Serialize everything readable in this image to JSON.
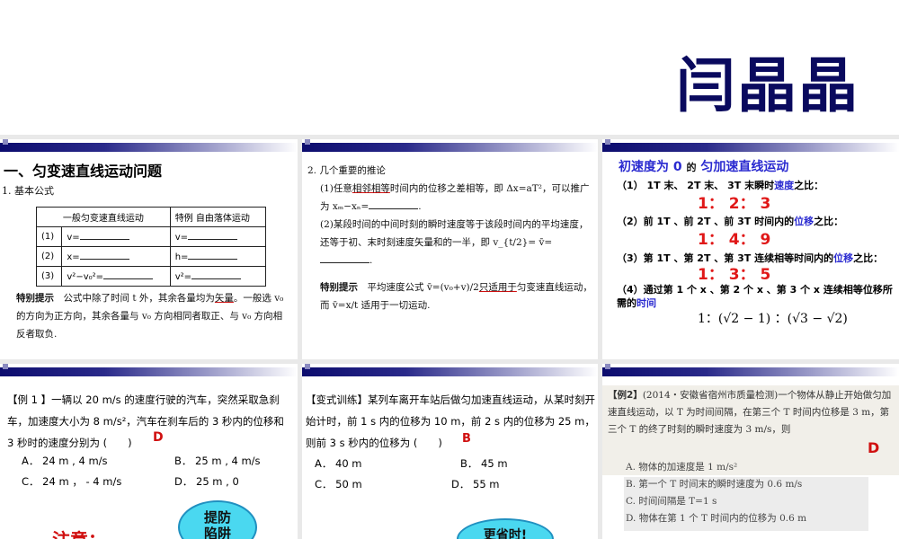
{
  "header": {
    "author_name": "闫晶晶"
  },
  "slide1": {
    "title": "一、匀变速直线运动问题",
    "subtitle": "1. 基本公式",
    "table": {
      "headers": [
        "一般匀变速直线运动",
        "特例 自由落体运动"
      ],
      "rows": [
        {
          "num": "(1)",
          "general": "v=",
          "special": "v="
        },
        {
          "num": "(2)",
          "general": "x=",
          "special": "h="
        },
        {
          "num": "(3)",
          "general": "v²−v₀²=",
          "special": "v²="
        }
      ]
    },
    "tip_label": "特别提示",
    "tip_text_1": "公式中除了时间 t 外，其余各量均为",
    "tip_highlight": "矢量",
    "tip_text_2": "。一般选 v₀ 的方向为正方向，其余各量与 v₀ 方向相同者取正、与 v₀ 方向相反者取负."
  },
  "slide2": {
    "heading": "2. 几个重要的推论",
    "p1_a": "(1)任意",
    "p1_hl": "相邻相等",
    "p1_b": "时间内的位移之差相等，即 Δx=aT²，可以推广为 xₘ−xₙ=",
    "p2": "(2)某段时间的中间时刻的瞬时速度等于该段时间内的平均速度，还等于初、末时刻速度矢量和的一半，即 v_{t/2}= v̄=",
    "tip_label": "特别提示",
    "tip_a": "平均速度公式 v̄=(v₀+v)/2",
    "tip_hl": "只适用于",
    "tip_b": "匀变速直线运动，而 v̄=x/t 适用于一切运动."
  },
  "slide3": {
    "title_a": "初速度为 0",
    "title_mid": "的",
    "title_b": "匀加速直线运动",
    "q1_a": "（1） 1T 末、 2T 末、 3T 末瞬时",
    "q1_kw": "速度",
    "q1_b": "之比：",
    "r1": "1： 2： 3",
    "q2_a": "（2）前 1T 、前 2T 、前 3T 时间内的",
    "q2_kw": "位移",
    "q2_b": "之比：",
    "r2": "1： 4： 9",
    "q3_a": "（3）第 1T 、第 2T 、第 3T 连续相等时间内的",
    "q3_kw": "位移",
    "q3_b": "之比：",
    "r3": "1： 3： 5",
    "q4_a": "（4）通过第 1 个 x 、第 2 个 x 、第 3 个 x 连续相等位移所需的",
    "q4_kw": "时间",
    "r4": "1：(√2 − 1) ：(√3 − √2)"
  },
  "slide4": {
    "question": "【例 1 】一辆以 20 m/s 的速度行驶的汽车，突然采取急刹车，加速度大小为 8 m/s²，汽车在刹车后的 3 秒内的位移和 3 秒时的速度分别为 (　　)",
    "answer": "D",
    "options": [
      "A． 24 m , 4 m/s",
      "B． 25 m , 4 m/s",
      "C． 24 m ， - 4 m/s",
      "D． 25 m , 0"
    ],
    "note": "注意：",
    "cloud": "提防陷阱"
  },
  "slide5": {
    "question": "【变式训练】某列车离开车站后做匀加速直线运动，从某时刻开始计时，前 1 s 内的位移为 10 m，前 2 s 内的位移为 25 m，则前 3 s 秒内的位移为 (　　)",
    "answer": "B",
    "options": [
      "A． 40 m",
      "B． 45 m",
      "C． 50 m",
      "D． 55 m"
    ],
    "cloud": "更省时!"
  },
  "slide6": {
    "label": "【例2】",
    "question": "(2014・安徽省宿州市质量检测)一个物体从静止开始做匀加速直线运动，以 T 为时间间隔，在第三个 T 时间内位移是 3 m，第三个 T 的终了时刻的瞬时速度为 3 m/s，则",
    "answer": "D",
    "options": [
      "A. 物体的加速度是 1 m/s²",
      "B. 第一个 T 时间末的瞬时速度为 0.6 m/s",
      "C. 时间间隔是 T=1 s",
      "D. 物体在第 1 个 T 时间内的位移为 0.6 m"
    ]
  }
}
